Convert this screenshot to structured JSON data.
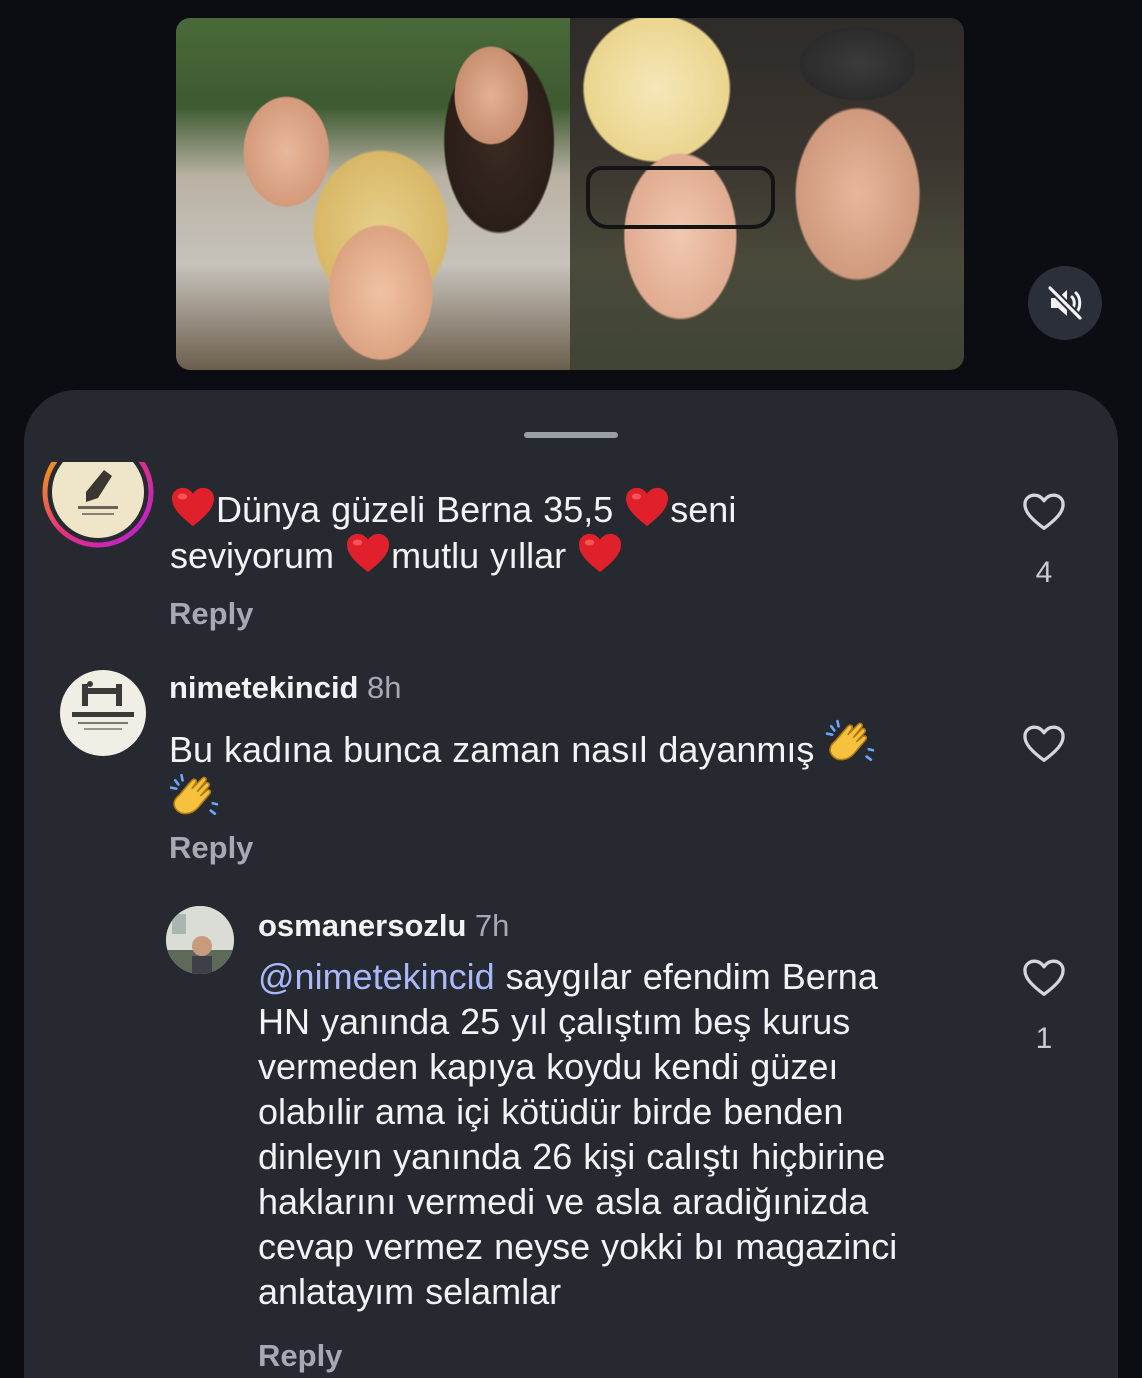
{
  "media": {
    "mute_icon": "speaker-muted-icon"
  },
  "comments": [
    {
      "username": "",
      "time": "",
      "text_parts": [
        "Dünya güzeli Berna 35,5",
        "seni",
        "seviyorum",
        "mutlu yıllar"
      ],
      "emoji": "heart",
      "reply_label": "Reply",
      "like_count": "4"
    },
    {
      "username": "nimetekincid",
      "time": "8h",
      "text": "Bu kadına bunca zaman nasıl dayanmış",
      "emoji": "clapping-hands",
      "reply_label": "Reply",
      "like_count": ""
    },
    {
      "username": "osmanersozlu",
      "time": "7h",
      "mention": "@nimetekincid",
      "text_lines": [
        "saygılar efendim Berna",
        "HN yanında 25 yıl çalıştım beş kurus",
        "vermeden kapıya koydu kendi güzeı",
        "olabılir ama içi kötüdür birde benden",
        "dinleyın yanında 26 kişi calıştı hiçbirine",
        "haklarını vermedi ve asla aradiğınizda",
        "cevap vermez neyse yokki bı magazinci",
        "anlatayım selamlar"
      ],
      "reply_label": "Reply",
      "like_count": "1"
    }
  ],
  "colors": {
    "sheet_bg": "#26292f",
    "page_bg": "#0b0d12",
    "muted_text": "#a6a9b1",
    "mention": "#a9b8f8",
    "heart": "#e0202a"
  }
}
